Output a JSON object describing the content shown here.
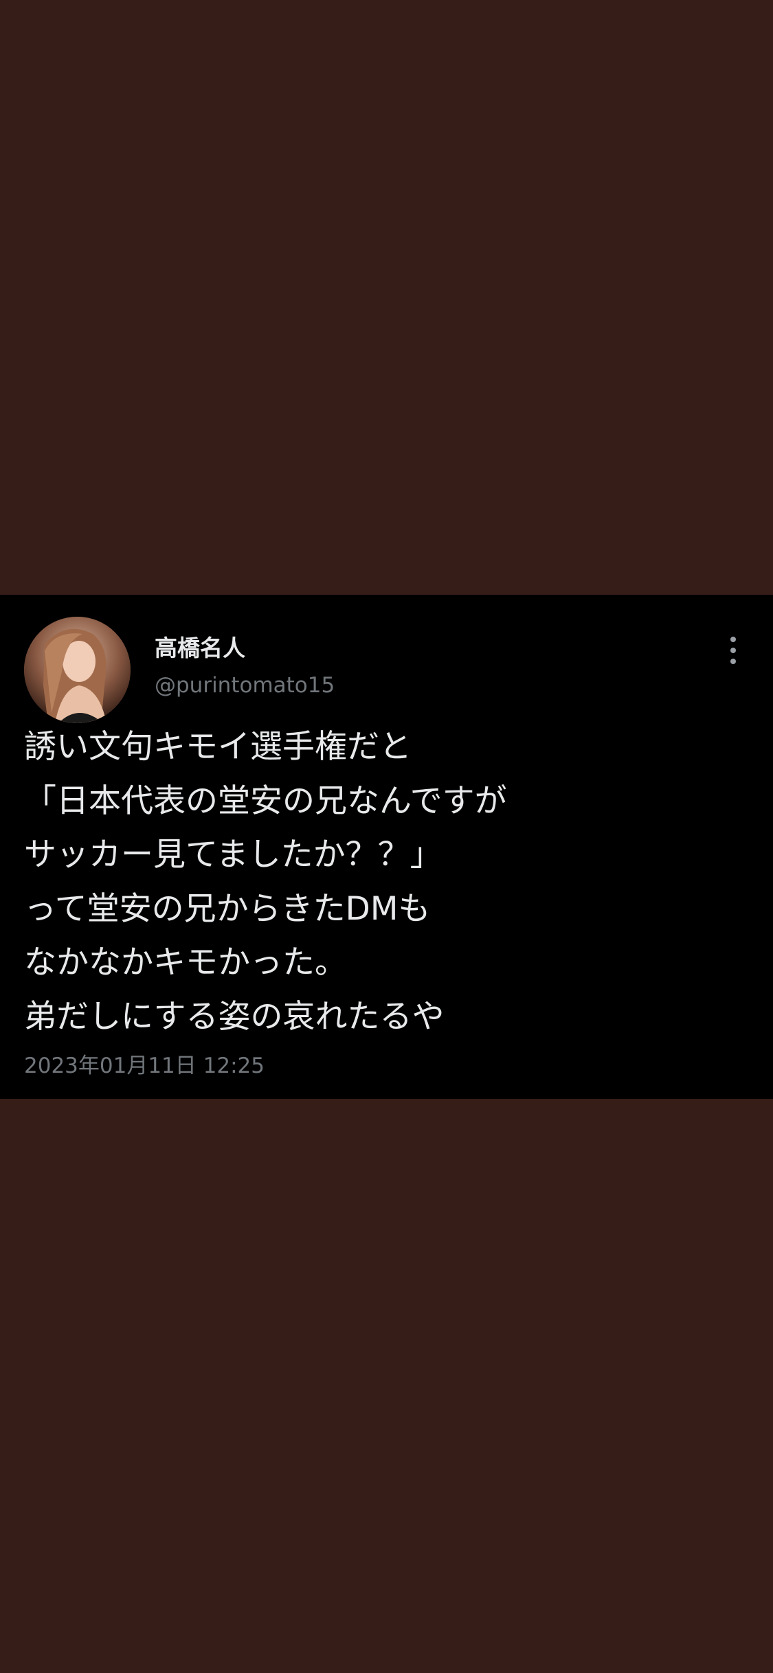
{
  "tweet": {
    "display_name": "高橋名人",
    "handle": "@purintomato15",
    "avatar_icon": "user-avatar-photo",
    "more_icon": "vertical-ellipsis-icon",
    "lines": [
      "誘い文句キモイ選手権だと",
      "「日本代表の堂安の兄なんですが",
      "サッカー見てましたか？？」",
      "って堂安の兄からきたDMも",
      "なかなかキモかった。",
      "弟だしにする姿の哀れたるや"
    ],
    "timestamp": "2023年01月11日 12:25"
  },
  "colors": {
    "background": "#371d18",
    "card": "#000000",
    "text_primary": "#e7e9ea",
    "text_secondary": "#71767b"
  }
}
